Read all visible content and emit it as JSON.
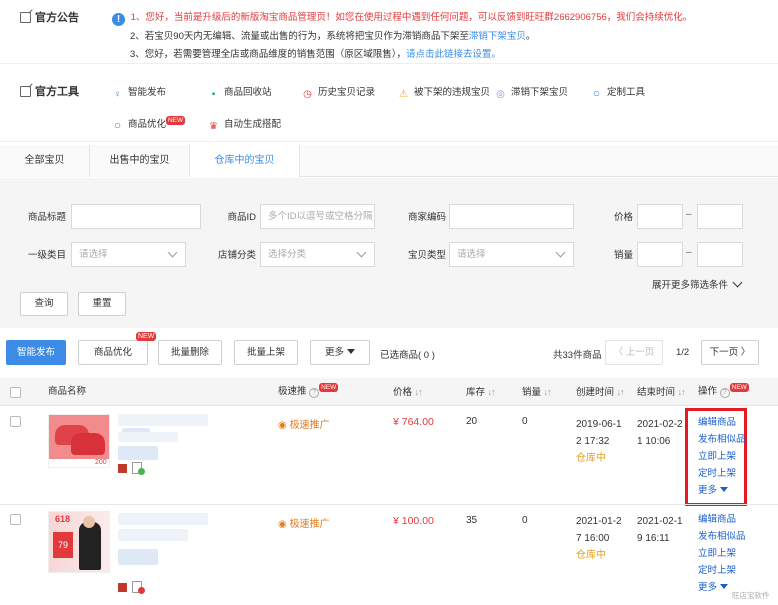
{
  "notice": {
    "title": "官方公告",
    "line1": "1、您好，当前是升级后的新版淘宝商品管理页！如您在使用过程中遇到任何问题，可以反馈到旺旺群2662906756，我们会持续优化。",
    "line2_pre": "2、若宝贝90天内无编辑、流量或出售的行为，系统将把宝贝作为滞销商品下架至",
    "line2_link": "滞销下架宝贝",
    "line2_post": "。",
    "line3_pre": "3、您好，若需要管理全店或商品维度的销售范围（原区域限售），",
    "line3_link": "请点击此链接去设置。"
  },
  "tools": {
    "title": "官方工具",
    "items": [
      {
        "label": "智能发布",
        "icon": "bulb-icon"
      },
      {
        "label": "商品回收站",
        "icon": "trash-icon"
      },
      {
        "label": "历史宝贝记录",
        "icon": "history-icon"
      },
      {
        "label": "被下架的违规宝贝",
        "icon": "warning-icon"
      },
      {
        "label": "滞销下架宝贝",
        "icon": "clock-icon"
      },
      {
        "label": "定制工具",
        "icon": "search-icon"
      },
      {
        "label": "商品优化",
        "icon": "search-icon",
        "badge": "NEW"
      },
      {
        "label": "自动生成搭配",
        "icon": "outfit-icon"
      }
    ]
  },
  "tabs": [
    "全部宝贝",
    "出售中的宝贝",
    "仓库中的宝贝"
  ],
  "filters": {
    "title_label": "商品标题",
    "id_label": "商品ID",
    "id_placeholder": "多个ID以逗号或空格分隔",
    "code_label": "商家编码",
    "price_label": "价格",
    "cat_label": "一级类目",
    "cat_placeholder": "请选择",
    "shopcat_label": "店铺分类",
    "shopcat_placeholder": "选择分类",
    "type_label": "宝贝类型",
    "type_placeholder": "请选择",
    "sales_label": "销量",
    "range_sep": "–",
    "more": "展开更多筛选条件",
    "query": "查询",
    "reset": "重置"
  },
  "actions": {
    "smart_publish": "智能发布",
    "optimize": "商品优化",
    "optimize_badge": "NEW",
    "batch_delete": "批量删除",
    "batch_list": "批量上架",
    "more": "更多",
    "selected": "已选商品( 0 )",
    "total": "共33件商品",
    "prev": "〈 上一页",
    "page": "1/2",
    "next": "下一页 〉"
  },
  "table": {
    "headers": {
      "name": "商品名称",
      "promo": "极速推",
      "promo_badge": "NEW",
      "price": "价格",
      "stock": "库存",
      "sales": "销量",
      "created": "创建时间",
      "ended": "结束时间",
      "ops": "操作",
      "ops_badge": "NEW"
    },
    "rows": [
      {
        "promo": "极速推广",
        "price": "¥ 764.00",
        "stock": "20",
        "sales": "0",
        "created_1": "2019-06-1",
        "created_2": "2 17:32",
        "status": "仓库中",
        "ended_1": "2021-02-2",
        "ended_2": "1 10:06",
        "ops": [
          "编辑商品",
          "发布相似品",
          "立即上架",
          "定时上架"
        ],
        "ops_more": "更多",
        "thumb_text": "200"
      },
      {
        "promo": "极速推广",
        "price": "¥ 100.00",
        "stock": "35",
        "sales": "0",
        "created_1": "2021-01-2",
        "created_2": "7 16:00",
        "status": "仓库中",
        "ended_1": "2021-02-1",
        "ended_2": "9 16:11",
        "ops": [
          "编辑商品",
          "发布相似品",
          "立即上架",
          "定时上架"
        ],
        "ops_more": "更多",
        "thumb_text": "618",
        "thumb_price": "79"
      }
    ]
  },
  "watermark": "旺店宝软件",
  "colors": {
    "accent": "#3c8ce7",
    "red": "#e4393c",
    "highlight": "#e6191e"
  }
}
